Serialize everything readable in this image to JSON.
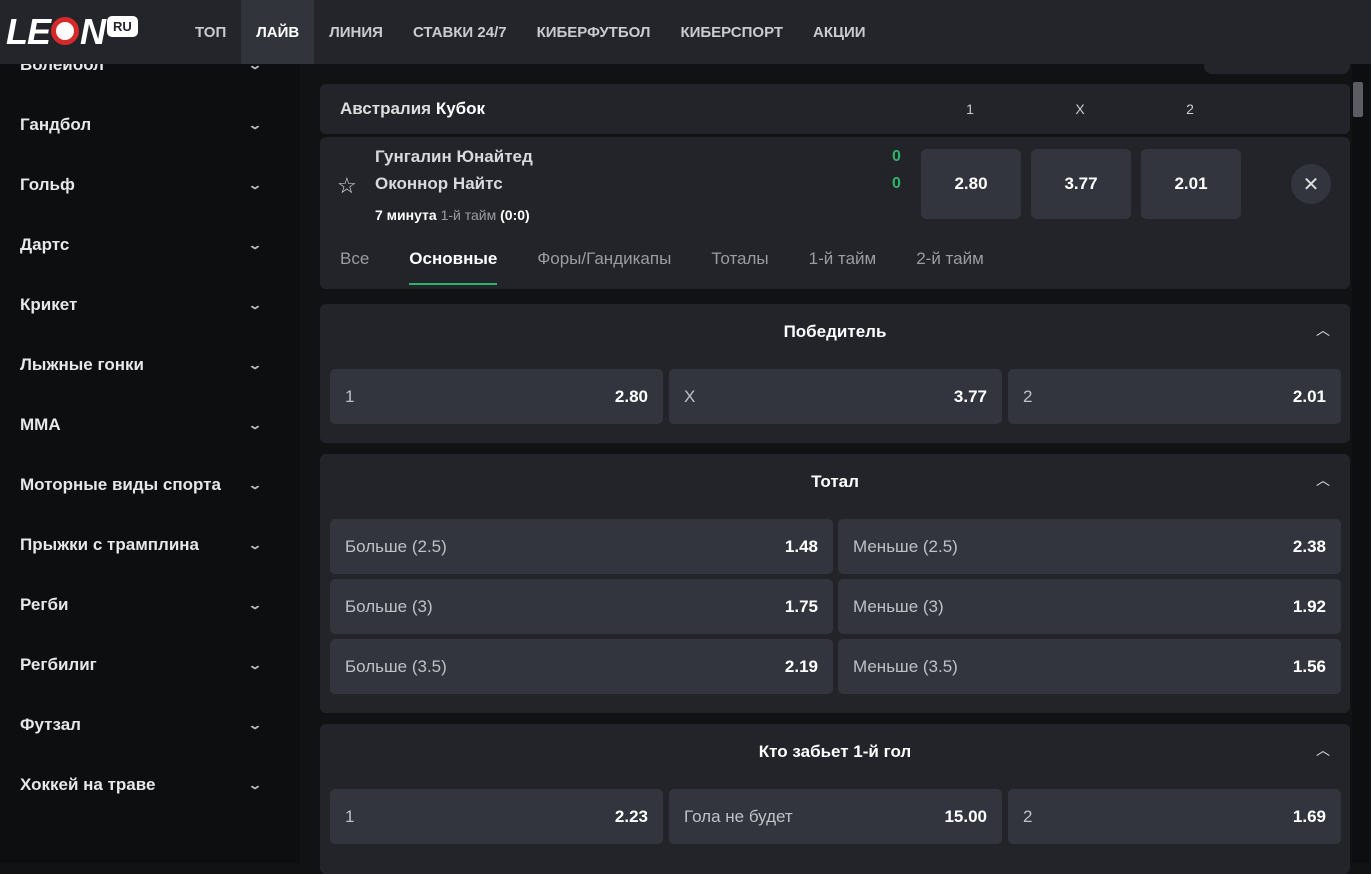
{
  "brand": {
    "logo": "LEON",
    "logo_suffix": "RU"
  },
  "nav": [
    "ТОП",
    "ЛАЙВ",
    "ЛИНИЯ",
    "СТАВКИ 24/7",
    "КИБЕРФУТБОЛ",
    "КИБЕРСПОРТ",
    "АКЦИИ"
  ],
  "sidebar": [
    "Волейбол",
    "Гандбол",
    "Гольф",
    "Дартс",
    "Крикет",
    "Лыжные гонки",
    "ММА",
    "Моторные виды спорта",
    "Прыжки с трамплина",
    "Регби",
    "Регбилиг",
    "Футзал",
    "Хоккей на траве"
  ],
  "event": {
    "league_country": "Австралия",
    "league_name": "Кубок",
    "cols": [
      "1",
      "X",
      "2"
    ],
    "team1": "Гунгалин Юнайтед",
    "team2": "Оконнор Найтс",
    "score1": "0",
    "score2": "0",
    "minute": "7 минута",
    "period": "1-й тайм",
    "period_score": "(0:0)",
    "odds": [
      "2.80",
      "3.77",
      "2.01"
    ],
    "tabs": [
      "Все",
      "Основные",
      "Форы/Гандикапы",
      "Тоталы",
      "1-й тайм",
      "2-й тайм"
    ],
    "active_tab": "Основные"
  },
  "markets": [
    {
      "title": "Победитель",
      "outcomes": [
        {
          "label": "1",
          "odd": "2.80"
        },
        {
          "label": "X",
          "odd": "3.77"
        },
        {
          "label": "2",
          "odd": "2.01"
        }
      ]
    },
    {
      "title": "Тотал",
      "outcomes": [
        {
          "label": "Больше (2.5)",
          "odd": "1.48"
        },
        {
          "label": "Меньше (2.5)",
          "odd": "2.38"
        },
        {
          "label": "Больше (3)",
          "odd": "1.75"
        },
        {
          "label": "Меньше (3)",
          "odd": "1.92"
        },
        {
          "label": "Больше (3.5)",
          "odd": "2.19"
        },
        {
          "label": "Меньше (3.5)",
          "odd": "1.56"
        }
      ]
    },
    {
      "title": "Кто забьет 1-й гол",
      "outcomes": [
        {
          "label": "1",
          "odd": "2.23"
        },
        {
          "label": "Гола не будет",
          "odd": "15.00"
        },
        {
          "label": "2",
          "odd": "1.69"
        }
      ]
    }
  ],
  "colors": {
    "accent": "#2fb36b",
    "card": "#222429",
    "button": "#32353d"
  }
}
